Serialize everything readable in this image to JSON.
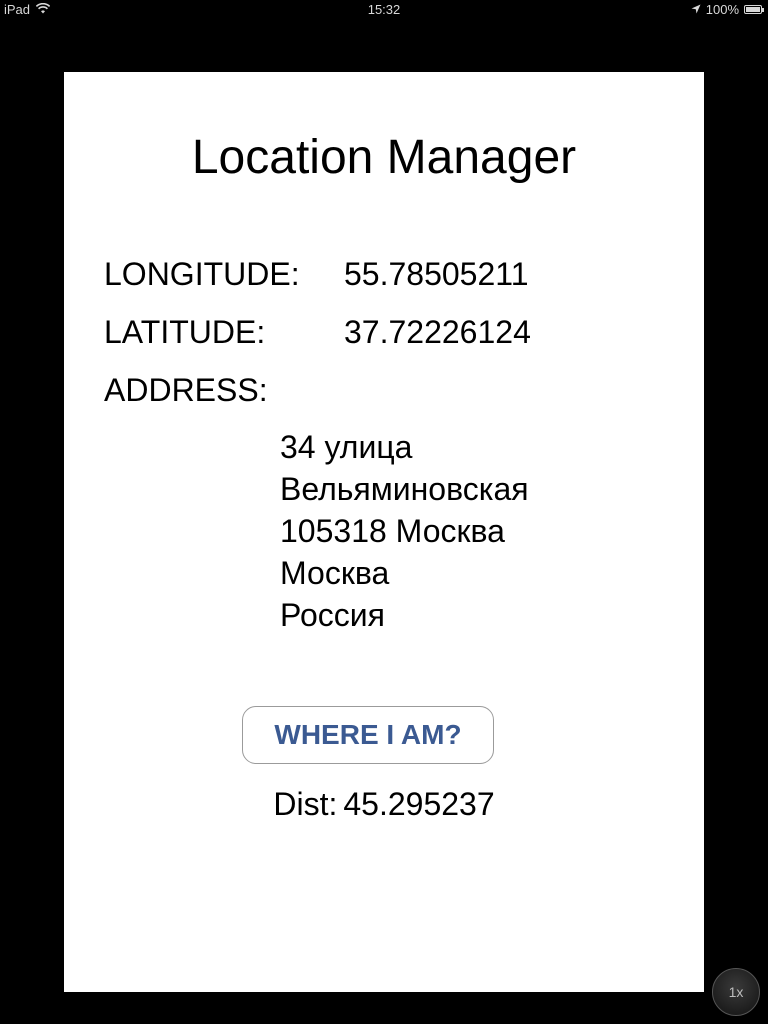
{
  "status_bar": {
    "device": "iPad",
    "time": "15:32",
    "battery": "100%",
    "icons": [
      "wifi-icon",
      "location-arrow-icon",
      "battery-icon"
    ]
  },
  "app": {
    "title": "Location Manager",
    "longitude_label": "LONGITUDE:",
    "longitude_value": "55.78505211",
    "latitude_label": "LATITUDE:",
    "latitude_value": "37.72226124",
    "address_label": "ADDRESS:",
    "address_lines": [
      "34 улица",
      "Вельяминовская",
      "105318 Москва",
      "Москва",
      "Россия"
    ],
    "button_label": "WHERE I AM?",
    "dist_label": "Dist:",
    "dist_value": "45.295237"
  },
  "zoom": {
    "label": "1x"
  },
  "colors": {
    "background": "#000000",
    "panel": "#ffffff",
    "button_text": "#3b5a92",
    "button_border": "#9b9b9b"
  }
}
